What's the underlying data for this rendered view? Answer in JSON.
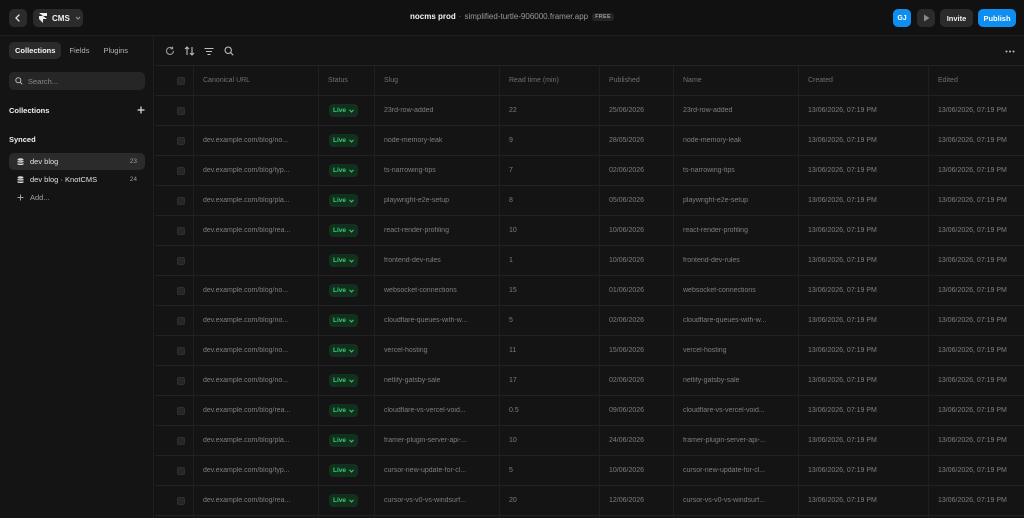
{
  "topbar": {
    "app_name": "CMS",
    "project": "nocms prod",
    "separator": "·",
    "domain": "simplified-turtle-906000.framer.app",
    "plan_badge": "FREE",
    "avatar_initials": "GJ",
    "invite_label": "Invite",
    "publish_label": "Publish",
    "accent_color": "#0e8ef0"
  },
  "sidebar": {
    "tabs": [
      {
        "label": "Collections",
        "active": true
      },
      {
        "label": "Fields",
        "active": false
      },
      {
        "label": "Plugins",
        "active": false
      }
    ],
    "search_placeholder": "Search...",
    "collections_heading": "Collections",
    "synced_heading": "Synced",
    "items": [
      {
        "label": "dev blog",
        "count": "23",
        "icon": "database-icon",
        "active": true
      },
      {
        "label": "dev blog · KnotCMS",
        "count": "24",
        "icon": "database-icon",
        "active": false
      }
    ],
    "add_label": "Add..."
  },
  "table": {
    "columns": [
      "Canonical URL",
      "Status",
      "Slug",
      "Read time (min)",
      "Published",
      "Name",
      "Created",
      "Edited"
    ],
    "status_color": "#2fd46f",
    "rows": [
      {
        "url": "",
        "status": "Live",
        "slug": "23rd-row-added",
        "read": "22",
        "published": "25/06/2026",
        "name": "23rd-row-added",
        "created": "13/06/2026, 07:19 PM",
        "edited": "13/06/2026, 07:19 PM"
      },
      {
        "url": "dev.example.com/blog/no...",
        "status": "Live",
        "slug": "node-memory-leak",
        "read": "9",
        "published": "28/05/2026",
        "name": "node-memory-leak",
        "created": "13/06/2026, 07:19 PM",
        "edited": "13/06/2026, 07:19 PM"
      },
      {
        "url": "dev.example.com/blog/typ...",
        "status": "Live",
        "slug": "ts-narrowing-tips",
        "read": "7",
        "published": "02/06/2026",
        "name": "ts-narrowing-tips",
        "created": "13/06/2026, 07:19 PM",
        "edited": "13/06/2026, 07:19 PM"
      },
      {
        "url": "dev.example.com/blog/pla...",
        "status": "Live",
        "slug": "playwright-e2e-setup",
        "read": "8",
        "published": "05/06/2026",
        "name": "playwright-e2e-setup",
        "created": "13/06/2026, 07:19 PM",
        "edited": "13/06/2026, 07:19 PM"
      },
      {
        "url": "dev.example.com/blog/rea...",
        "status": "Live",
        "slug": "react-render-profiling",
        "read": "10",
        "published": "10/06/2026",
        "name": "react-render-profiling",
        "created": "13/06/2026, 07:19 PM",
        "edited": "13/06/2026, 07:19 PM"
      },
      {
        "url": "",
        "status": "Live",
        "slug": "frontend-dev-rules",
        "read": "1",
        "published": "10/06/2026",
        "name": "frontend-dev-rules",
        "created": "13/06/2026, 07:19 PM",
        "edited": "13/06/2026, 07:19 PM"
      },
      {
        "url": "dev.example.com/blog/no...",
        "status": "Live",
        "slug": "websocket-connections",
        "read": "15",
        "published": "01/06/2026",
        "name": "websocket-connections",
        "created": "13/06/2026, 07:19 PM",
        "edited": "13/06/2026, 07:19 PM"
      },
      {
        "url": "dev.example.com/blog/no...",
        "status": "Live",
        "slug": "cloudflare-queues-with-w...",
        "read": "5",
        "published": "02/06/2026",
        "name": "cloudflare-queues-with-w...",
        "created": "13/06/2026, 07:19 PM",
        "edited": "13/06/2026, 07:19 PM"
      },
      {
        "url": "dev.example.com/blog/no...",
        "status": "Live",
        "slug": "vercel-hosting",
        "read": "11",
        "published": "15/06/2026",
        "name": "vercel-hosting",
        "created": "13/06/2026, 07:19 PM",
        "edited": "13/06/2026, 07:19 PM"
      },
      {
        "url": "dev.example.com/blog/no...",
        "status": "Live",
        "slug": "netlify-gatsby-sale",
        "read": "17",
        "published": "02/06/2026",
        "name": "netlify-gatsby-sale",
        "created": "13/06/2026, 07:19 PM",
        "edited": "13/06/2026, 07:19 PM"
      },
      {
        "url": "dev.example.com/blog/rea...",
        "status": "Live",
        "slug": "cloudflare-vs-vercel-void...",
        "read": "0.5",
        "published": "09/06/2026",
        "name": "cloudflare-vs-vercel-void...",
        "created": "13/06/2026, 07:19 PM",
        "edited": "13/06/2026, 07:19 PM"
      },
      {
        "url": "dev.example.com/blog/pla...",
        "status": "Live",
        "slug": "framer-plugin-server-api-...",
        "read": "10",
        "published": "24/06/2026",
        "name": "framer-plugin-server-api-...",
        "created": "13/06/2026, 07:19 PM",
        "edited": "13/06/2026, 07:19 PM"
      },
      {
        "url": "dev.example.com/blog/typ...",
        "status": "Live",
        "slug": "cursor-new-update-for-cl...",
        "read": "5",
        "published": "10/06/2026",
        "name": "cursor-new-update-for-cl...",
        "created": "13/06/2026, 07:19 PM",
        "edited": "13/06/2026, 07:19 PM"
      },
      {
        "url": "dev.example.com/blog/rea...",
        "status": "Live",
        "slug": "cursor-vs-v0-vs-windsurf...",
        "read": "20",
        "published": "12/06/2026",
        "name": "cursor-vs-v0-vs-windsurf...",
        "created": "13/06/2026, 07:19 PM",
        "edited": "13/06/2026, 07:19 PM"
      }
    ]
  }
}
